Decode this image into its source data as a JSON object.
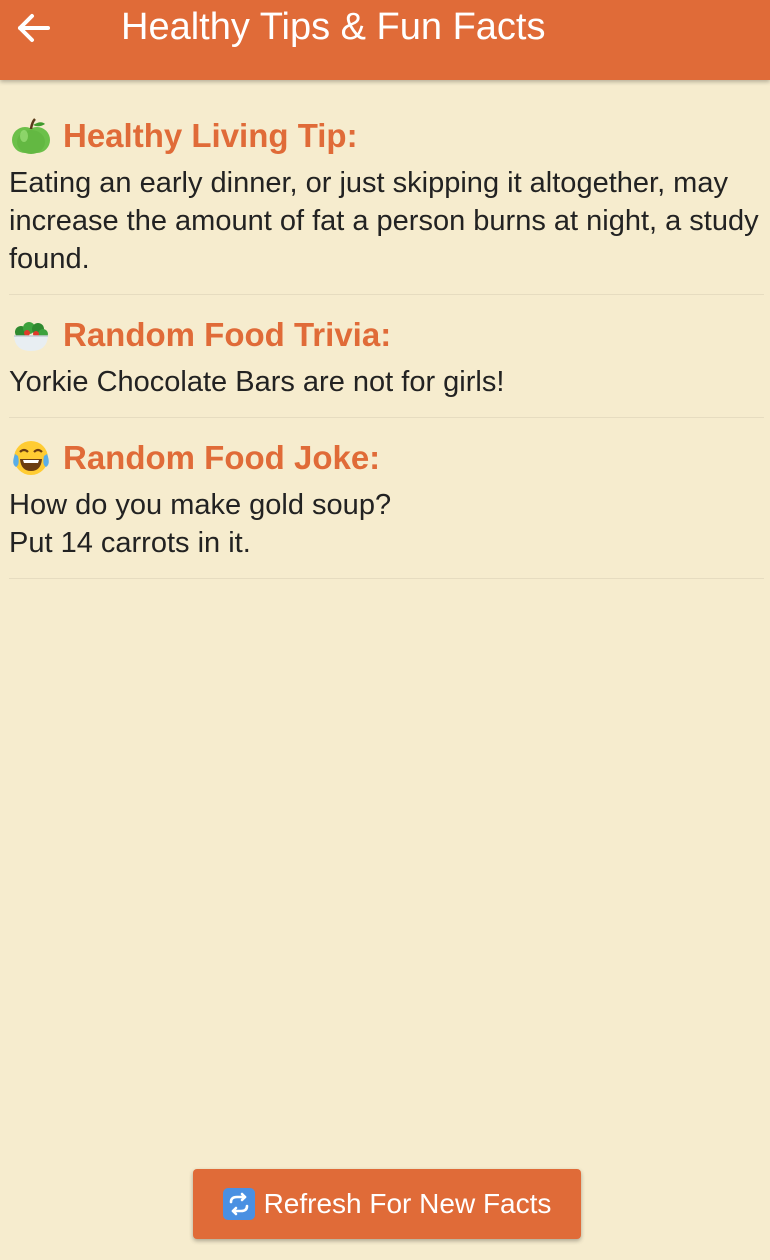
{
  "app_bar": {
    "title": "Healthy Tips & Fun Facts",
    "back_icon": "arrow-left-icon",
    "color": "#e06b38"
  },
  "sections": [
    {
      "icon": "green-apple-icon",
      "heading": "Healthy Living Tip:",
      "lines": [
        "Eating an early dinner, or just skipping it altogether, may increase the amount of fat a person burns at night, a study found."
      ]
    },
    {
      "icon": "salad-bowl-icon",
      "heading": "Random Food Trivia:",
      "lines": [
        "Yorkie Chocolate Bars are not for girls!"
      ]
    },
    {
      "icon": "tears-of-joy-icon",
      "heading": "Random Food Joke:",
      "lines": [
        "How do you make gold soup?",
        "Put 14 carrots in it."
      ]
    }
  ],
  "refresh_button": {
    "icon": "refresh-arrows-icon",
    "label": "Refresh For New Facts"
  },
  "colors": {
    "accent": "#e06b38",
    "background": "#f6ecce",
    "text": "#222222"
  }
}
